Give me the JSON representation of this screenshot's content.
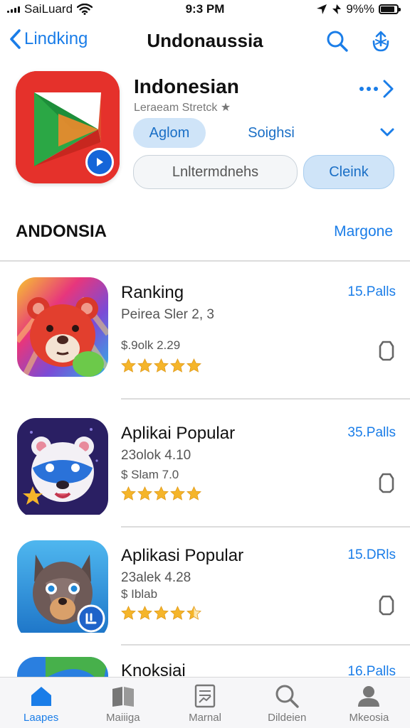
{
  "status": {
    "carrier": "SaiLuard",
    "time": "9:3 PM",
    "battery": "9%%"
  },
  "nav": {
    "back_label": "Lindking",
    "title": "Undonaussia"
  },
  "hero": {
    "name": "Indonesian",
    "subtitle": "Leraeam Stretck ★",
    "button_primary": "Aglom",
    "button_secondary": "Soighsi",
    "input_placeholder": "Lnltermdnehs",
    "button_clear": "Cleink"
  },
  "section": {
    "title": "ANDONSIA",
    "link": "Margone"
  },
  "apps": [
    {
      "name": "Ranking",
      "line2": "Peirea Sler 2, 3",
      "line3": "$.9olk 2.29",
      "price": "15.Palls",
      "rating": 5,
      "icon": "red-bear-icon"
    },
    {
      "name": "Aplikai Popular",
      "line2": "23olok 4.10",
      "line3": "$ Slam  7.0",
      "price": "35.Palls",
      "rating": 5,
      "icon": "panda-bear-icon"
    },
    {
      "name": "Aplikasi Popular",
      "line2": "23alek 4.28",
      "line3": "$ Iblab",
      "price": "15.DRls",
      "rating": 4.5,
      "icon": "wolf-icon"
    },
    {
      "name": "Knoksiai",
      "line2": "",
      "line3": "",
      "price": "16.Palls",
      "rating": 0,
      "icon": "blue-app-icon"
    }
  ],
  "tabs": [
    {
      "label": "Laapes",
      "icon": "home-icon",
      "active": true
    },
    {
      "label": "Maiiiga",
      "icon": "book-icon",
      "active": false
    },
    {
      "label": "Marnal",
      "icon": "document-icon",
      "active": false
    },
    {
      "label": "Dildeien",
      "icon": "search-icon",
      "active": false
    },
    {
      "label": "Mkeosia",
      "icon": "person-icon",
      "active": false
    }
  ],
  "colors": {
    "accent": "#1a7de8",
    "star": "#f5b52a",
    "hero_icon_bg": "#e5312b"
  }
}
